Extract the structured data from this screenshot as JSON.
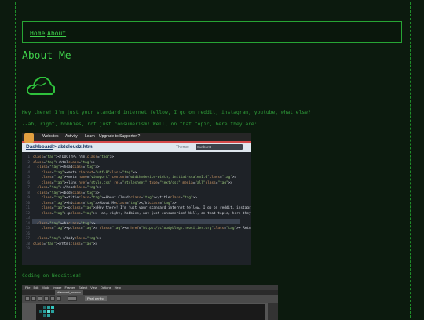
{
  "nav": {
    "links": [
      "Home",
      "About"
    ]
  },
  "page": {
    "title": "About Me",
    "intro": "Hey there! I'm just your standard internet fellow, I go on reddit, instagram, youtube, what else?",
    "hobbies": "--ah, right, hobbies, not just consumerism! Well, on that topic, here they are:",
    "coding_caption": "Coding on Neocities!"
  },
  "neocities_editor": {
    "menu": [
      "Websites",
      "Activity",
      "Learn",
      "Upgrade to Supporter ?"
    ],
    "breadcrumb_root": "Dashboard",
    "breadcrumb_file": "> abtcloudz.html",
    "theme_label": "Theme:",
    "theme_value": "Sunburst",
    "line_numbers": [
      "1",
      "2",
      "3",
      "4",
      "5",
      "6",
      "7",
      "8",
      "9",
      "10",
      "11",
      "12",
      "13",
      "14",
      "15",
      "16",
      "17",
      "18",
      "19"
    ],
    "code_lines": [
      "<!DOCTYPE html>",
      "<html>",
      "  <head>",
      "    <meta charset=\"utf-8\">",
      "    <meta name=\"viewport\" content=\"width=device-width, initial-scale=1.0\">",
      "    <link href=\"style.css\" rel=\"stylesheet\" type=\"text/css\" media=\"all\">",
      "  </head>",
      "  <body>",
      "    <title>About Cloudz</title>",
      "    <h1>About Me</h1>",
      "    <p>Hey there! I'm just your standard internet fellow, I go on reddit, instagram, youtube, what else?</",
      "    <p>--ah, right, hobbies, not just consumerism! Well, on that topic, here they are:</p>",
      "",
      "  <br>",
      "    <p> <a href=\"https://cloudyblogz.neocities.org\"> Return from whence you've came? </a> </p>",
      "",
      "  </body>",
      "</html>",
      ""
    ]
  },
  "image_editor": {
    "menu": [
      "File",
      "Edit",
      "Mode",
      "Image",
      "Frames",
      "Select",
      "View",
      "Options",
      "Help"
    ],
    "tab": "diamond_room ×",
    "zoom": "100%",
    "mode": "Pixel perfect"
  },
  "colors": {
    "background": "#0c1a0e",
    "accent": "#3fd14b",
    "text": "#2f9c3a"
  }
}
